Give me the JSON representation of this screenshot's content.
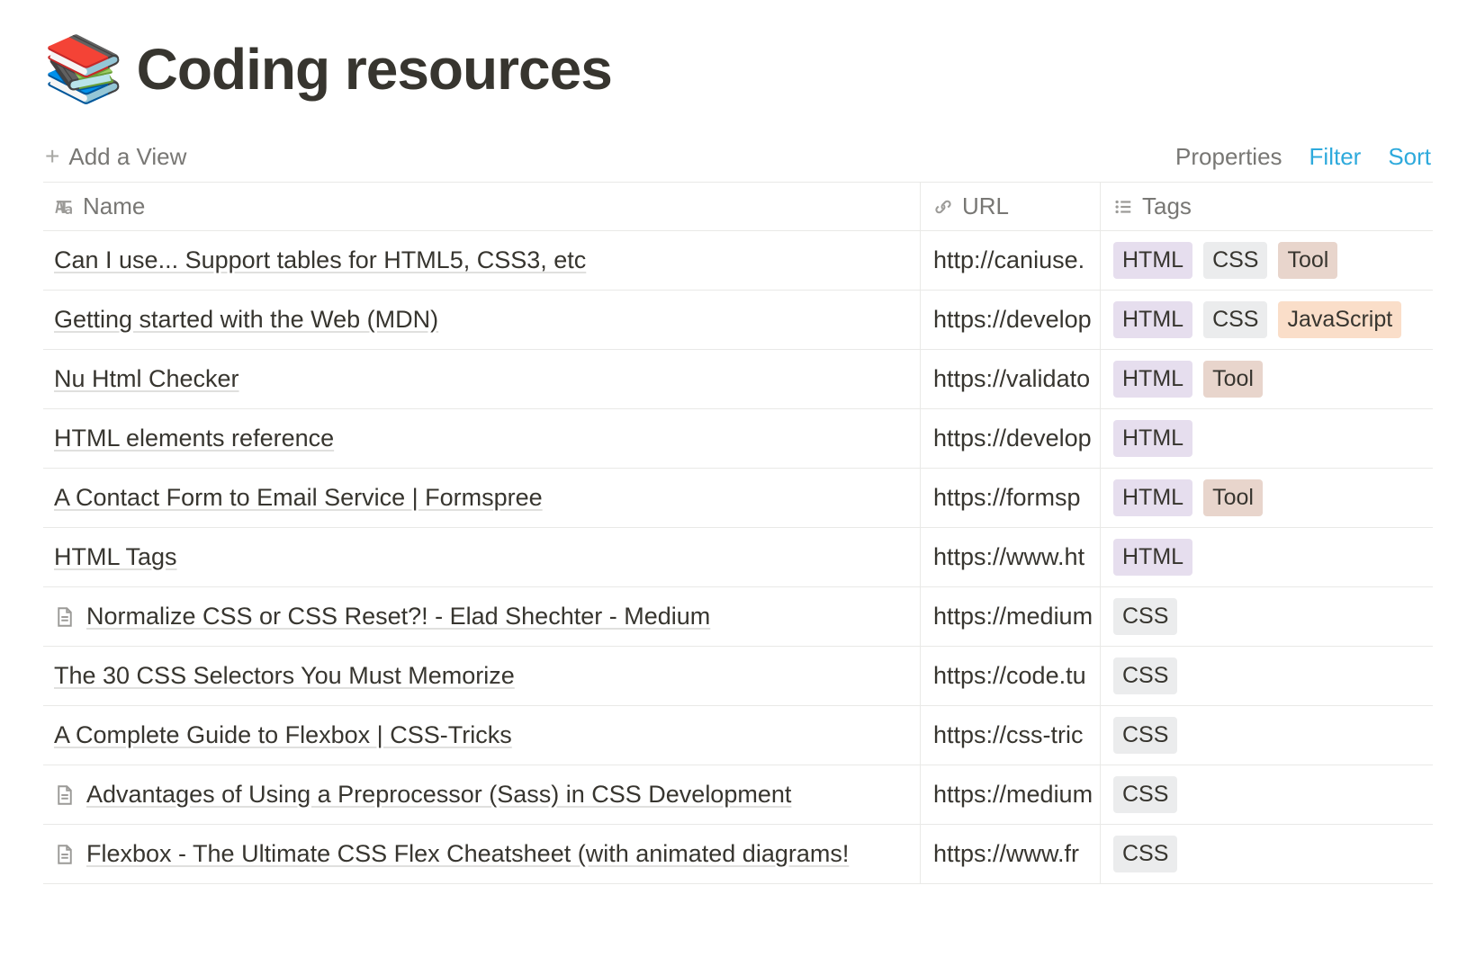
{
  "page": {
    "icon": "📚",
    "title": "Coding resources"
  },
  "toolbar": {
    "add_view": "Add a View",
    "properties": "Properties",
    "filter": "Filter",
    "sort": "Sort"
  },
  "columns": {
    "name": "Name",
    "url": "URL",
    "tags": "Tags"
  },
  "tagColors": {
    "HTML": "#e6deee",
    "CSS": "#ebeced",
    "Tool": "#e8d5cc",
    "JavaScript": "#fadec9"
  },
  "rows": [
    {
      "icon": null,
      "name": "Can I use... Support tables for HTML5, CSS3, etc",
      "url": "http://caniuse.",
      "tags": [
        "HTML",
        "CSS",
        "Tool"
      ]
    },
    {
      "icon": null,
      "name": "Getting started with the Web (MDN)",
      "url": "https://develop",
      "tags": [
        "HTML",
        "CSS",
        "JavaScript"
      ]
    },
    {
      "icon": null,
      "name": "Nu Html Checker",
      "url": "https://validato",
      "tags": [
        "HTML",
        "Tool"
      ]
    },
    {
      "icon": null,
      "name": "HTML elements reference",
      "url": "https://develop",
      "tags": [
        "HTML"
      ]
    },
    {
      "icon": null,
      "name": "A Contact Form to Email Service | Formspree",
      "url": "https://formsp",
      "tags": [
        "HTML",
        "Tool"
      ]
    },
    {
      "icon": null,
      "name": "HTML Tags",
      "url": "https://www.ht",
      "tags": [
        "HTML"
      ]
    },
    {
      "icon": "doc",
      "name": "Normalize CSS or CSS Reset?! - Elad Shechter - Medium",
      "url": "https://medium",
      "tags": [
        "CSS"
      ]
    },
    {
      "icon": null,
      "name": "The 30 CSS Selectors You Must Memorize",
      "url": "https://code.tu",
      "tags": [
        "CSS"
      ]
    },
    {
      "icon": null,
      "name": "A Complete Guide to Flexbox | CSS-Tricks",
      "url": "https://css-tric",
      "tags": [
        "CSS"
      ]
    },
    {
      "icon": "doc",
      "name": "Advantages of Using a Preprocessor (Sass) in CSS Development",
      "url": "https://medium",
      "tags": [
        "CSS"
      ]
    },
    {
      "icon": "doc",
      "name": "Flexbox - The Ultimate CSS Flex Cheatsheet (with animated diagrams!",
      "url": "https://www.fr",
      "tags": [
        "CSS"
      ]
    }
  ]
}
